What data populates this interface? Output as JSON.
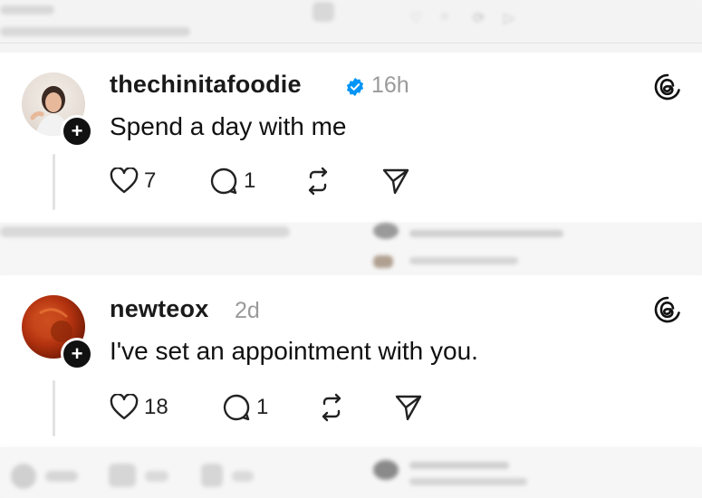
{
  "posts": [
    {
      "username": "thechinitafoodie",
      "verified": true,
      "time": "16h",
      "text": "Spend a day with me",
      "likes": "7",
      "replies": "1",
      "icons": [
        "heart-icon",
        "comment-icon",
        "repost-icon",
        "share-icon",
        "threads-logo-icon",
        "follow-plus-icon"
      ]
    },
    {
      "username": "newteox",
      "verified": false,
      "time": "2d",
      "text": "I've set an appointment with you.",
      "likes": "18",
      "replies": "1",
      "icons": [
        "heart-icon",
        "comment-icon",
        "repost-icon",
        "share-icon",
        "threads-logo-icon",
        "follow-plus-icon"
      ]
    }
  ],
  "colors": {
    "verified_blue": "#0095f6",
    "text": "#111111",
    "muted": "#9a9a9a"
  }
}
